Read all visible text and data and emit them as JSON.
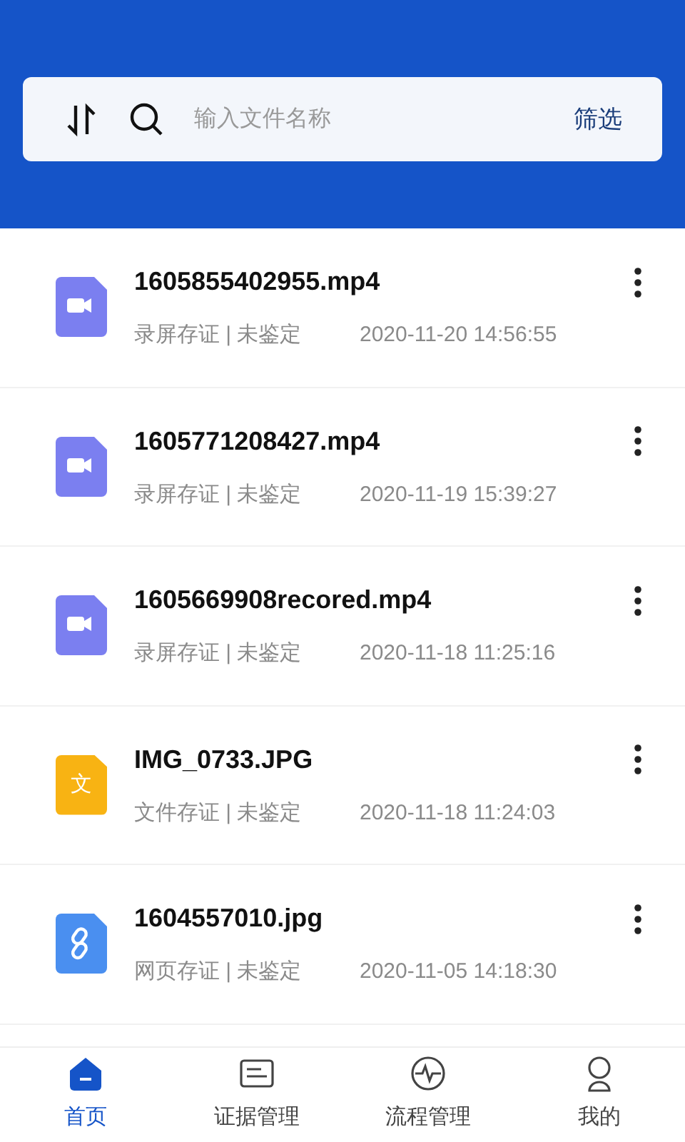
{
  "search": {
    "placeholder": "输入文件名称",
    "filter_label": "筛选"
  },
  "files": [
    {
      "kind": "video",
      "name": "1605855402955.mp4",
      "category": "录屏存证 | 未鉴定",
      "time": "2020-11-20 14:56:55"
    },
    {
      "kind": "video",
      "name": "1605771208427.mp4",
      "category": "录屏存证 | 未鉴定",
      "time": "2020-11-19 15:39:27"
    },
    {
      "kind": "video",
      "name": "1605669908recored.mp4",
      "category": "录屏存证 | 未鉴定",
      "time": "2020-11-18 11:25:16"
    },
    {
      "kind": "document",
      "glyph": "文",
      "name": "IMG_0733.JPG",
      "category": "文件存证 | 未鉴定",
      "time": "2020-11-18 11:24:03"
    },
    {
      "kind": "link",
      "name": "1604557010.jpg",
      "category": "网页存证 | 未鉴定",
      "time": "2020-11-05 14:18:30"
    }
  ],
  "tab_bar": [
    {
      "kind": "home",
      "label": "首页",
      "selected": true
    },
    {
      "kind": "evidence",
      "label": "证据管理",
      "selected": false
    },
    {
      "kind": "pulse",
      "label": "流程管理",
      "selected": false
    },
    {
      "kind": "profile",
      "label": "我的",
      "selected": false
    }
  ]
}
